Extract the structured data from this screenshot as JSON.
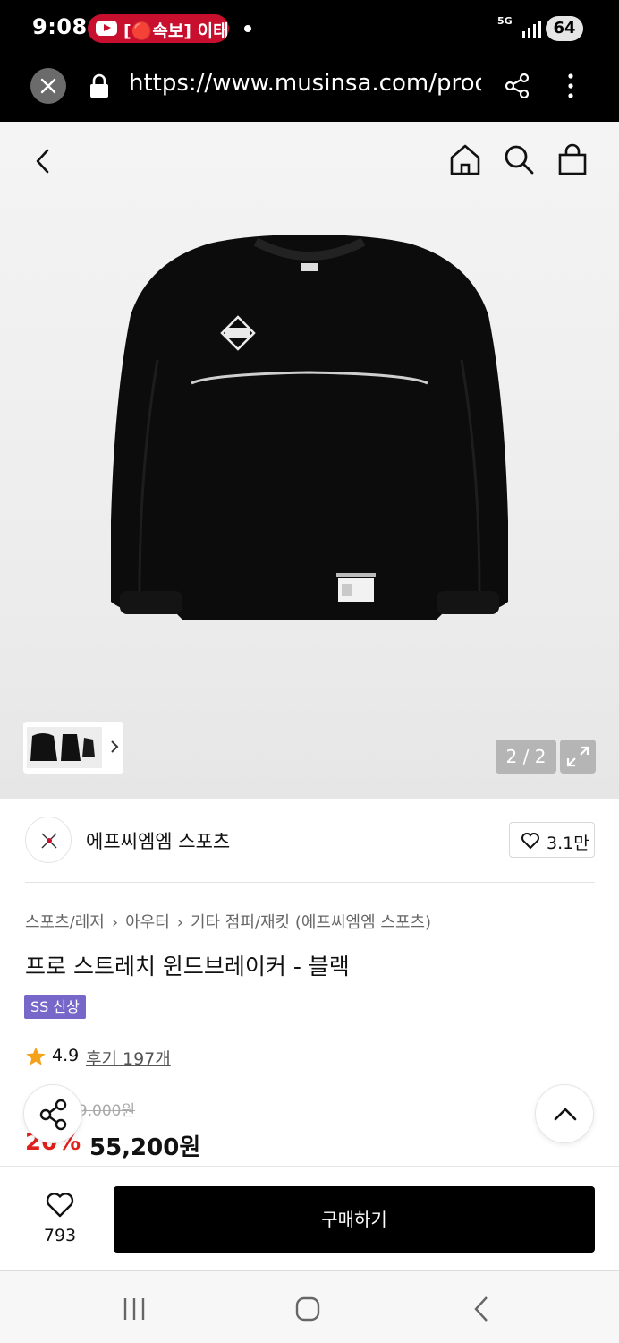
{
  "status_bar": {
    "time": "9:08",
    "notification_text": "[🔴속보] 이태",
    "network": "5G",
    "battery": "64"
  },
  "browser": {
    "url": "https://www.musinsa.com/products"
  },
  "gallery": {
    "counter": "2 / 2"
  },
  "brand": {
    "name": "에프씨엠엠 스포츠",
    "likes": "3.1만"
  },
  "breadcrumb": [
    "스포츠/레저",
    "아우터",
    "기타 점퍼/재킷 (에프씨엠엠 스포츠)"
  ],
  "product": {
    "title": "프로 스트레치 윈드브레이커 - 블랙",
    "badge": "SS 신상",
    "rating": "4.9",
    "reviews": "후기 197개",
    "original_price": "69,000원",
    "discount": "20%",
    "price": "55,200원"
  },
  "action_bar": {
    "wish_count": "793",
    "buy_label": "구매하기"
  },
  "colors": {
    "discount_red": "#e0201b",
    "badge_purple": "#7667c9",
    "star_orange": "#f5a21b",
    "buy_black": "#000000"
  }
}
